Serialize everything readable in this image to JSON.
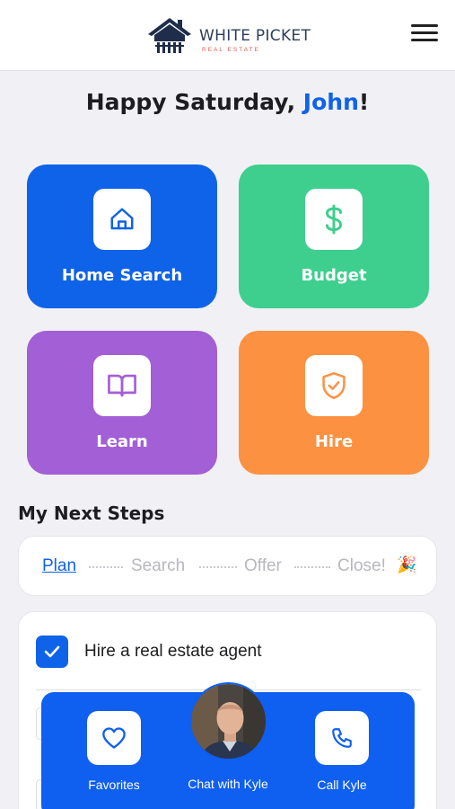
{
  "header": {
    "logo_name": "WHITE PICKET",
    "logo_sub": "REAL ESTATE",
    "menu_icon": "hamburger-menu-icon"
  },
  "greeting": {
    "prefix": "Happy Saturday, ",
    "name": "John",
    "suffix": "!"
  },
  "tiles": [
    {
      "label": "Home Search",
      "icon": "home-icon",
      "color": "#0f63e8"
    },
    {
      "label": "Budget",
      "icon": "dollar-icon",
      "color": "#3ecf8e"
    },
    {
      "label": "Learn",
      "icon": "book-icon",
      "color": "#a35fd6"
    },
    {
      "label": "Hire",
      "icon": "shield-check-icon",
      "color": "#fd9142"
    }
  ],
  "next_steps": {
    "title": "My Next Steps",
    "stages": [
      "Plan",
      "Search",
      "Offer",
      "Close!"
    ],
    "active_stage": "Plan",
    "close_emoji": "🎉",
    "tasks": [
      {
        "label": "Hire a real estate agent",
        "checked": true
      }
    ]
  },
  "bottom_bar": {
    "favorites_label": "Favorites",
    "chat_label": "Chat with Kyle",
    "call_label": "Call Kyle"
  },
  "colors": {
    "accent": "#0f63e8",
    "bottom_bar": "#0f5ff0"
  }
}
